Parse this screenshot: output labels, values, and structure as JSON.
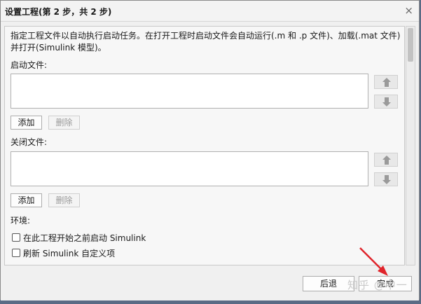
{
  "window": {
    "title": "设置工程(第 2 步，共 2 步)",
    "close_glyph": "×"
  },
  "main": {
    "description": "指定工程文件以自动执行启动任务。在打开工程时启动文件会自动运行(.m 和 .p 文件)、加载(.mat 文件)并打开(Simulink 模型)。",
    "startup": {
      "label": "启动文件:",
      "add_label": "添加",
      "remove_label": "删除"
    },
    "shutdown": {
      "label": "关闭文件:",
      "add_label": "添加",
      "remove_label": "删除"
    },
    "environment": {
      "label": "环境:",
      "options": [
        {
          "label": "在此工程开始之前启动 Simulink",
          "checked": false
        },
        {
          "label": "刷新 Simulink 自定义项",
          "checked": false
        }
      ]
    }
  },
  "footer": {
    "back_label": "后退",
    "finish_label": "完成"
  },
  "overlay": {
    "watermark": "知乎 @中一",
    "arrow_color": "#e0242b"
  }
}
